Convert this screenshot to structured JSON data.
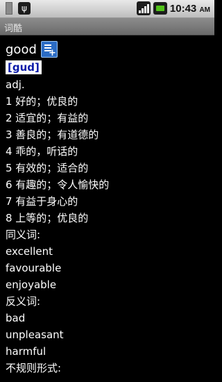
{
  "status_bar": {
    "time": "10:43",
    "ampm": "AM"
  },
  "title_bar": {
    "title": "词酷"
  },
  "entry": {
    "word": "good",
    "phonetic": "[gud]",
    "pos": "adj.",
    "definitions": [
      "1 好的；优良的",
      "2 适宜的；有益的",
      "3 善良的；有道德的",
      "4 乖的，听话的",
      "5 有效的；适合的",
      "6 有趣的；令人愉快的",
      "7 有益于身心的",
      "8 上等的；优良的"
    ],
    "synonyms_label": "同义词:",
    "synonyms": [
      "excellent",
      "favourable",
      "enjoyable"
    ],
    "antonyms_label": "反义词:",
    "antonyms": [
      "bad",
      "unpleasant",
      "harmful"
    ],
    "irregular_label": "不规则形式:"
  },
  "icons": [
    "sim-icon",
    "usb-icon",
    "signal-icon",
    "battery-icon",
    "add-to-wordbook-icon"
  ]
}
